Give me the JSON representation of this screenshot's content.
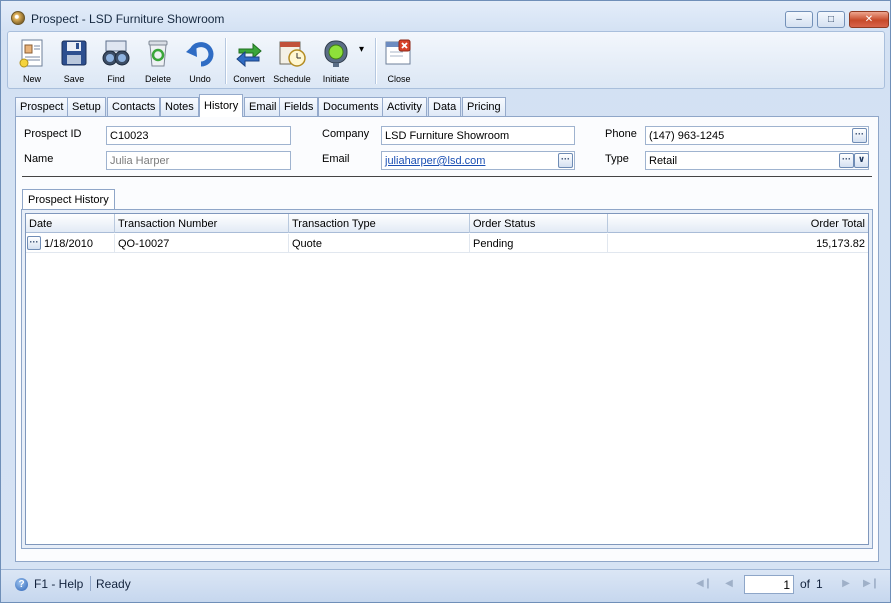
{
  "window": {
    "title": "Prospect - LSD Furniture Showroom",
    "min_label": "‒",
    "max_label": "□",
    "close_label": "✕"
  },
  "toolbar": {
    "items": [
      {
        "label": "New",
        "icon": "new-document-icon"
      },
      {
        "label": "Save",
        "icon": "floppy-disk-icon"
      },
      {
        "label": "Find",
        "icon": "binoculars-icon"
      },
      {
        "label": "Delete",
        "icon": "recycle-bin-icon"
      },
      {
        "label": "Undo",
        "icon": "undo-arrow-icon"
      },
      {
        "label": "Convert",
        "icon": "convert-arrows-icon"
      },
      {
        "label": "Schedule",
        "icon": "calendar-clock-icon"
      },
      {
        "label": "Initiate",
        "icon": "traffic-light-icon"
      },
      {
        "label": "Close",
        "icon": "close-window-icon"
      }
    ],
    "dropdown_glyph": "▾"
  },
  "tabs": [
    "Prospect",
    "Setup",
    "Contacts",
    "Notes",
    "History",
    "Email",
    "Fields",
    "Documents",
    "Activity",
    "Data",
    "Pricing"
  ],
  "active_tab": "History",
  "form": {
    "prospect_id_label": "Prospect ID",
    "prospect_id": "C10023",
    "name_label": "Name",
    "name": "Julia Harper",
    "company_label": "Company",
    "company": "LSD Furniture Showroom",
    "email_label": "Email",
    "email": "juliaharper@lsd.com",
    "phone_label": "Phone",
    "phone": "(147) 963-1245",
    "type_label": "Type",
    "type": "Retail",
    "ellipsis": "···",
    "dropdown": "∨"
  },
  "history": {
    "subtab": "Prospect History",
    "columns": [
      "Date",
      "Transaction Number",
      "Transaction Type",
      "Order Status",
      "Order Total"
    ],
    "rows": [
      {
        "date": "1/18/2010",
        "number": "QO-10027",
        "type": "Quote",
        "status": "Pending",
        "total": "15,173.82"
      }
    ]
  },
  "status": {
    "help_glyph": "?",
    "help": "F1 - Help",
    "state": "Ready",
    "page": "1",
    "of_label": "of",
    "total_pages": "1",
    "first": "◀❙",
    "prev": "◀",
    "next": "▶",
    "last": "▶❙"
  },
  "colors": {
    "accent": "#2c62b5",
    "link": "#1a4fb3"
  }
}
